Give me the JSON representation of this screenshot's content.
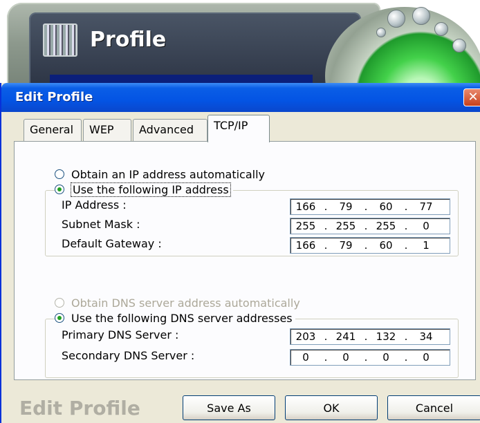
{
  "background_window": {
    "title": "Profile"
  },
  "dialog": {
    "title": "Edit Profile",
    "close_glyph": "✕",
    "tabs": [
      {
        "label": "General",
        "selected": false
      },
      {
        "label": "WEP",
        "selected": false
      },
      {
        "label": "Advanced",
        "selected": false
      },
      {
        "label": "TCP/IP",
        "selected": true
      }
    ],
    "ip_section": {
      "auto_option": {
        "label": "Obtain an IP address automatically",
        "checked": false
      },
      "manual_option": {
        "label": "Use the following IP address",
        "checked": true
      },
      "fields": [
        {
          "label": "IP Address :",
          "octets": [
            "166",
            "79",
            "60",
            "77"
          ]
        },
        {
          "label": "Subnet Mask :",
          "octets": [
            "255",
            "255",
            "255",
            "0"
          ]
        },
        {
          "label": "Default Gateway :",
          "octets": [
            "166",
            "79",
            "60",
            "1"
          ]
        }
      ]
    },
    "dns_section": {
      "auto_option": {
        "label": "Obtain DNS server address automatically",
        "checked": false,
        "disabled": true
      },
      "manual_option": {
        "label": "Use the following DNS server addresses",
        "checked": true
      },
      "fields": [
        {
          "label": "Primary DNS Server :",
          "octets": [
            "203",
            "241",
            "132",
            "34"
          ]
        },
        {
          "label": "Secondary DNS Server :",
          "octets": [
            "0",
            "0",
            "0",
            "0"
          ]
        }
      ]
    },
    "footer": {
      "watermark": "Edit Profile",
      "save_as_label": "Save As",
      "ok_label": "OK",
      "cancel_label": "Cancel"
    }
  },
  "colors": {
    "titlebar": "#0454e4",
    "dialog_bg": "#ece9d8",
    "radio_dot": "#21a121",
    "close_button": "#c8401b"
  },
  "icons": [
    "profile-app-icon",
    "close-icon",
    "radio-icon"
  ]
}
